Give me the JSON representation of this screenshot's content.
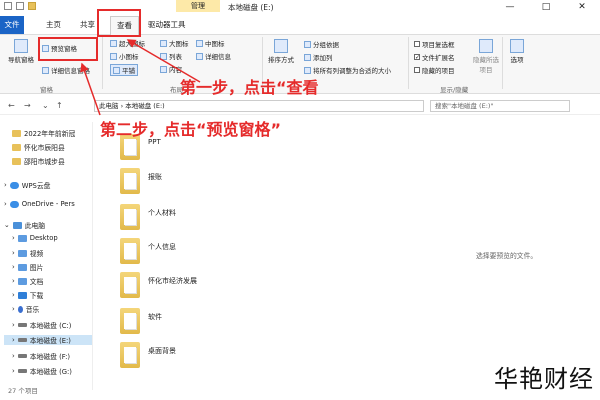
{
  "titlebar": {
    "context_label": "管理",
    "title": "本地磁盘 (E:)",
    "min": "—",
    "max": "□",
    "close": "✕"
  },
  "tabs": [
    "文件",
    "主页",
    "共享",
    "查看",
    "驱动器工具"
  ],
  "ribbon": {
    "panes": [
      "导航窗格",
      "预览窗格",
      "详细信息窗格"
    ],
    "pane_group": "窗格",
    "layout": [
      "超大图标",
      "大图标",
      "中图标",
      "小图标",
      "列表",
      "详细信息",
      "平铺",
      "内容"
    ],
    "layout_group": "布局",
    "sort_label": "排序方式",
    "group_by": "分组依据",
    "add_columns": "添加列",
    "fit_columns": "将所有列调整为合适的大小",
    "show": [
      "项目复选框",
      "文件扩展名",
      "隐藏的项目"
    ],
    "show_group": "显示/隐藏",
    "hide_selected": "隐藏所选项目",
    "options": "选项"
  },
  "address": {
    "path": "此电脑 › 本地磁盘 (E:)",
    "search_placeholder": "搜索\"本地磁盘 (E:)\""
  },
  "sidebar": {
    "items": [
      "2022年年前新冠",
      "怀化市辰阳县",
      "邵阳市城步县",
      "WPS云盘",
      "OneDrive - Pers",
      "此电脑",
      "Desktop",
      "视频",
      "图片",
      "文档",
      "下载",
      "音乐",
      "本地磁盘 (C:)",
      "本地磁盘 (E:)",
      "本地磁盘 (F:)",
      "本地磁盘 (G:)"
    ]
  },
  "files": [
    "PPT",
    "报账",
    "个人材料",
    "个人信息",
    "怀化市经济发展",
    "软件",
    "桌面背景"
  ],
  "preview_text": "选择要预览的文件。",
  "status": "27 个项目",
  "annotations": {
    "step1": "第一步，点击“查看",
    "step2": "第二步，点击“预览窗格”"
  },
  "watermark": "华艳财经"
}
